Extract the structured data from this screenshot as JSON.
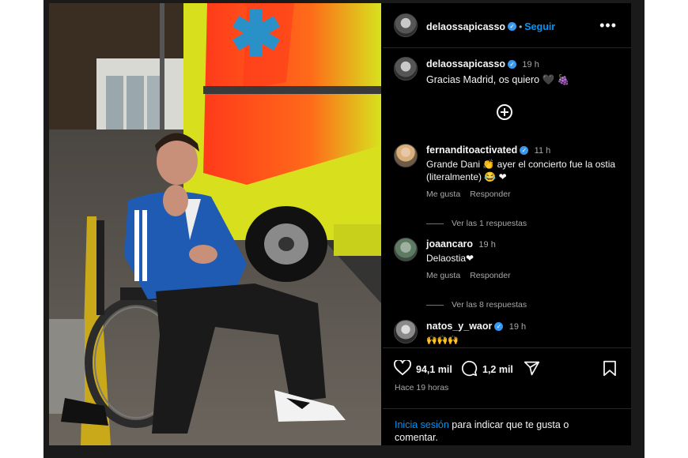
{
  "colors": {
    "accent": "#0095f6",
    "verified": "#3897f0",
    "background": "#000000"
  },
  "header": {
    "username": "delaossapicasso",
    "follow_label": "Seguir",
    "separator": "•",
    "more_label": "•••"
  },
  "caption": {
    "username": "delaossapicasso",
    "time": "19 h",
    "text": "Gracias Madrid, os quiero 🖤 🍇"
  },
  "comments": [
    {
      "username": "fernanditoactivated",
      "time": "11 h",
      "text": "Grande Dani 👏 ayer el concierto fue la ostia (literalmente) 😂 ❤",
      "like_label": "Me gusta",
      "reply_label": "Responder",
      "view_replies": "Ver las 1 respuestas"
    },
    {
      "username": "joaancaro",
      "time": "19 h",
      "text": "Delaostia❤",
      "like_label": "Me gusta",
      "reply_label": "Responder",
      "view_replies": "Ver las 8 respuestas"
    },
    {
      "username": "natos_y_waor",
      "time": "19 h",
      "text": "🙌🙌🙌"
    }
  ],
  "stats": {
    "likes": "94,1 mil",
    "comments": "1,2 mil",
    "posted": "Hace 19 horas"
  },
  "login": {
    "link_label": "Inicia sesión",
    "rest_text": " para indicar que te gusta o comentar."
  },
  "icons": {
    "like": "heart-icon",
    "comment": "comment-bubble-icon",
    "share": "send-icon",
    "save": "bookmark-icon",
    "add": "add-circle-icon",
    "more": "more-options-icon",
    "verified": "verified-badge-icon"
  }
}
